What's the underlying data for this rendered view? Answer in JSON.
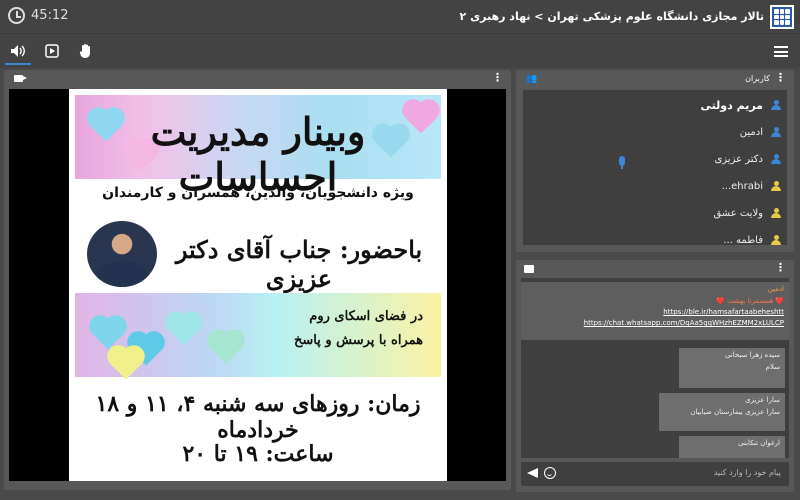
{
  "header": {
    "timer": "45:12",
    "title": "تالار مجازی دانشگاه علوم پزشکی تهران > نهاد رهبری ۲"
  },
  "toolbar": {
    "buttons": [
      {
        "name": "speaker-icon",
        "active": true
      },
      {
        "name": "screen-share-icon",
        "active": false
      },
      {
        "name": "raise-hand-icon",
        "active": false
      }
    ]
  },
  "poster": {
    "title": "وبینار مدیریت احساسات",
    "subtitle": "ویژه دانشجویان، والدین، همسران و کارمندان",
    "presence": "باحضور: جناب آقای دکتر عزیزی",
    "line1": "در فضای اسکای روم",
    "line2": "همراه با پرسش و پاسخ",
    "when": "زمان: روزهای سه شنبه ۴، ۱۱ و ۱۸ خردادماه",
    "hours": "ساعت: ۱۹ تا ۲۰"
  },
  "users": {
    "label": "کاربران",
    "items": [
      {
        "name": "مریم دولتی",
        "role": "admin"
      },
      {
        "name": "ادمین",
        "role": "admin"
      },
      {
        "name": "دکتر عزیزی",
        "role": "admin",
        "mic": true
      },
      {
        "name": "ehrabi...",
        "role": "guest"
      },
      {
        "name": "ولایت عشق",
        "role": "guest"
      },
      {
        "name": "فاطمه ...",
        "role": "guest"
      }
    ]
  },
  "chat": {
    "messages": [
      {
        "sender": "ادمین",
        "text": "❤️ همسفرتا بهشت ❤️",
        "links": [
          "https://ble.ir/hamsafartaabeheshtt",
          "https://chat.whatsapp.com/DqAa5qqWHzhEZMM2xLULCP"
        ]
      },
      {
        "sender": "سیده زهرا سبحانی",
        "text": "سلام"
      },
      {
        "sender": "سارا عزیزی",
        "text": "سارا عزیزی بیمارستان ضیاییان"
      },
      {
        "sender": "ارغوان تنکابنی",
        "text": ""
      }
    ],
    "input_placeholder": "پیام خود را وارد کنید"
  }
}
